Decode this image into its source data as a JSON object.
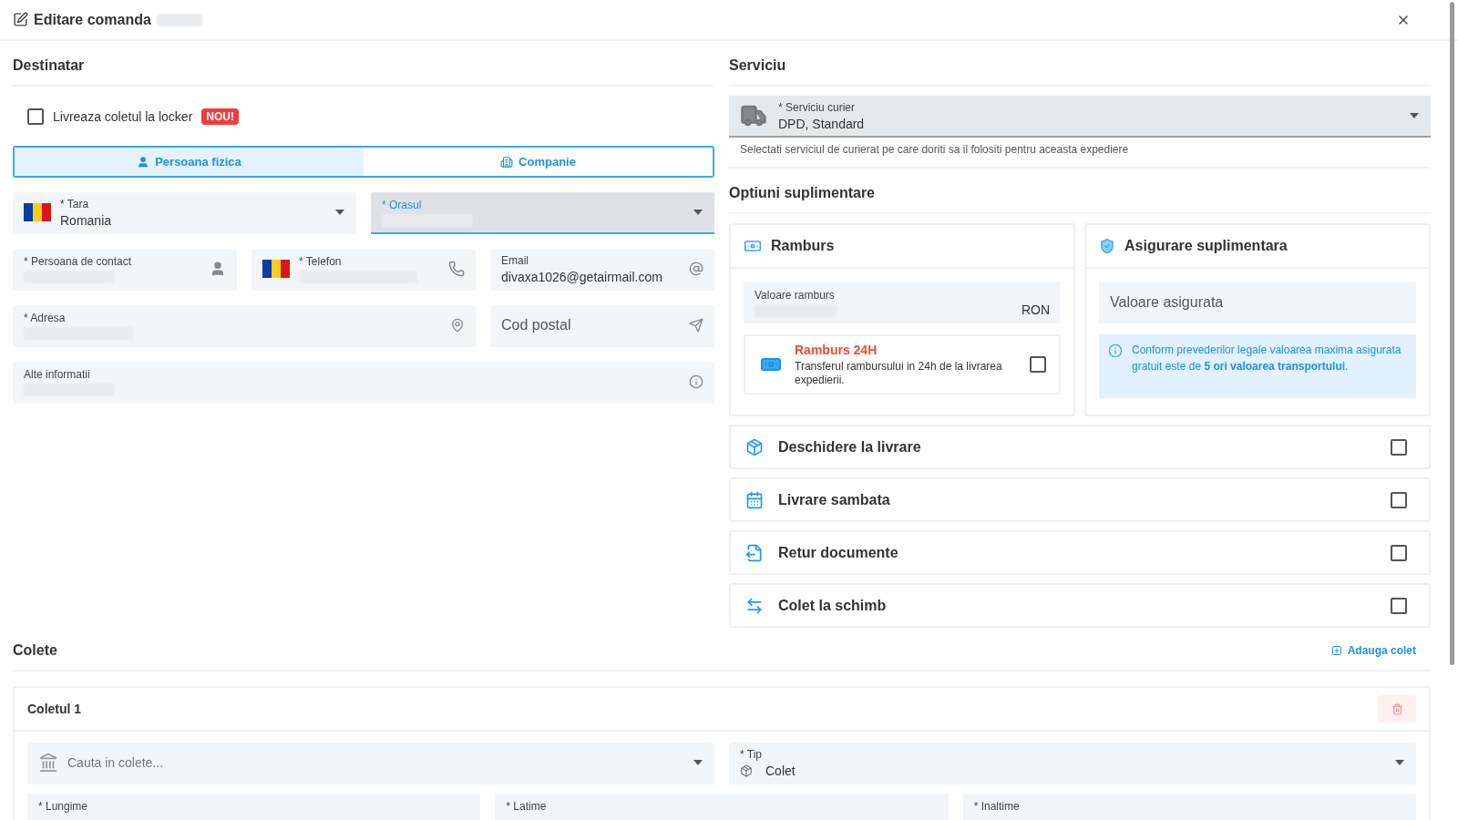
{
  "dialog": {
    "title": "Editare comanda",
    "title_redacted": true
  },
  "recipient": {
    "heading": "Destinatar",
    "locker": {
      "label": "Livreaza coletul la locker",
      "badge": "NOU!",
      "checked": false
    },
    "tabs": [
      {
        "label": "Persoana fizica",
        "kind": "person",
        "selected": true
      },
      {
        "label": "Companie",
        "kind": "company",
        "selected": false
      }
    ],
    "field_rows": [
      [
        {
          "kind": "country",
          "label": "* Tara",
          "value": "Romania",
          "dropdown": true,
          "focused": false
        },
        {
          "kind": "city",
          "label": "* Orasul",
          "redacted": true,
          "dropdown": true,
          "focused": true
        }
      ],
      [
        {
          "kind": "contact",
          "label": "* Persoana de contact",
          "redacted": true,
          "focused": false
        },
        {
          "kind": "phone",
          "label": "* Telefon",
          "redacted": true,
          "focused": false
        },
        {
          "kind": "email",
          "label": "Email",
          "value": "divaxa1026@getairmail.com",
          "focused": false
        }
      ],
      [
        {
          "kind": "address",
          "label": "* Adresa",
          "redacted": true,
          "focused": false
        },
        {
          "kind": "postcode",
          "placeholder": "Cod postal",
          "focused": false
        }
      ],
      [
        {
          "kind": "notes",
          "label": "Alte informatii",
          "redacted": true,
          "focused": false
        }
      ]
    ]
  },
  "service": {
    "heading": "Serviciu",
    "courier": {
      "label": "* Serviciu curier",
      "value": "DPD, Standard"
    },
    "hint": "Selectati serviciul de curierat pe care doriti sa il folositi pentru aceasta expediere"
  },
  "extras": {
    "heading": "Optiuni suplimentare",
    "cod": {
      "title": "Ramburs",
      "field_label": "Valoare ramburs",
      "redacted": true,
      "unit": "RON",
      "express": {
        "title": "Ramburs 24H",
        "description": "Transferul rambursului in 24h de la livrarea expedierii.",
        "checked": false
      }
    },
    "insurance": {
      "title": "Asigurare suplimentara",
      "placeholder": "Valoare asigurata",
      "note": "Conform prevederilor legale valoarea maxima asigurata gratuit este de **5 ori valoarea transportului**."
    },
    "options": [
      {
        "kind": "open",
        "label": "Deschidere la livrare",
        "checked": false
      },
      {
        "kind": "saturday",
        "label": "Livrare sambata",
        "checked": false
      },
      {
        "kind": "documents",
        "label": "Retur documente",
        "checked": false
      },
      {
        "kind": "exchange",
        "label": "Colet la schimb",
        "checked": false
      }
    ]
  },
  "parcels": {
    "heading": "Colete",
    "add_label": "Adauga colet",
    "items": [
      {
        "title": "Coletul 1",
        "search_placeholder": "Cauta in colete...",
        "type_label": "* Tip",
        "type_value": "Colet",
        "dimension_labels": [
          "* Lungime",
          "* Latime",
          "* Inaltime"
        ]
      }
    ]
  }
}
